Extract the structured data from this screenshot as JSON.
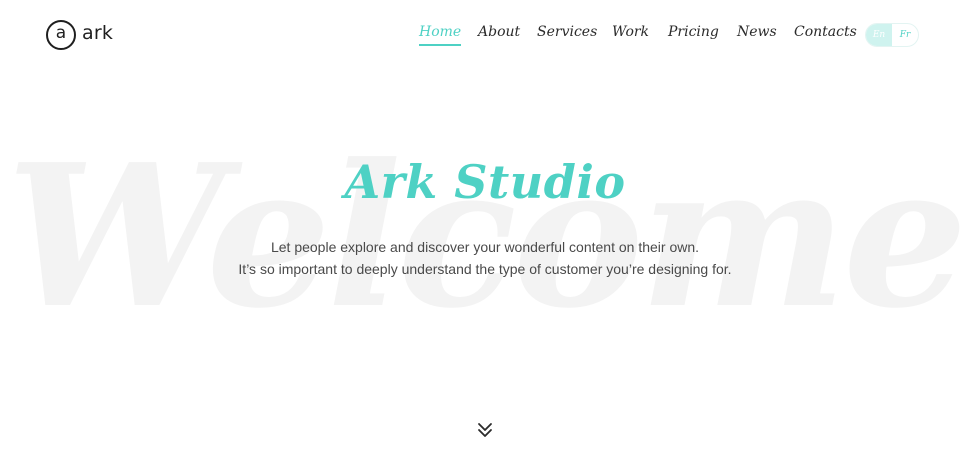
{
  "brand": {
    "mark": "a",
    "name": "ark"
  },
  "nav": {
    "items": [
      {
        "label": "Home",
        "active": true
      },
      {
        "label": "About",
        "active": false
      },
      {
        "label": "Services",
        "active": false
      },
      {
        "label": "Work",
        "active": false
      },
      {
        "label": "Pricing",
        "active": false
      },
      {
        "label": "News",
        "active": false
      },
      {
        "label": "Contacts",
        "active": false
      }
    ]
  },
  "language": {
    "options": [
      "En",
      "Fr"
    ],
    "selected": "En"
  },
  "hero": {
    "watermark": "Welcome",
    "title": "Ark Studio",
    "lines": [
      "Let people explore and discover your wonderful content on their own.",
      "It’s so important to deeply understand the type of customer you’re designing for."
    ]
  },
  "colors": {
    "accent": "#4ed1c4",
    "text": "#2b2b2b",
    "watermark": "#f3f3f3"
  },
  "icons": {
    "scroll": "double-chevron-down-icon"
  }
}
